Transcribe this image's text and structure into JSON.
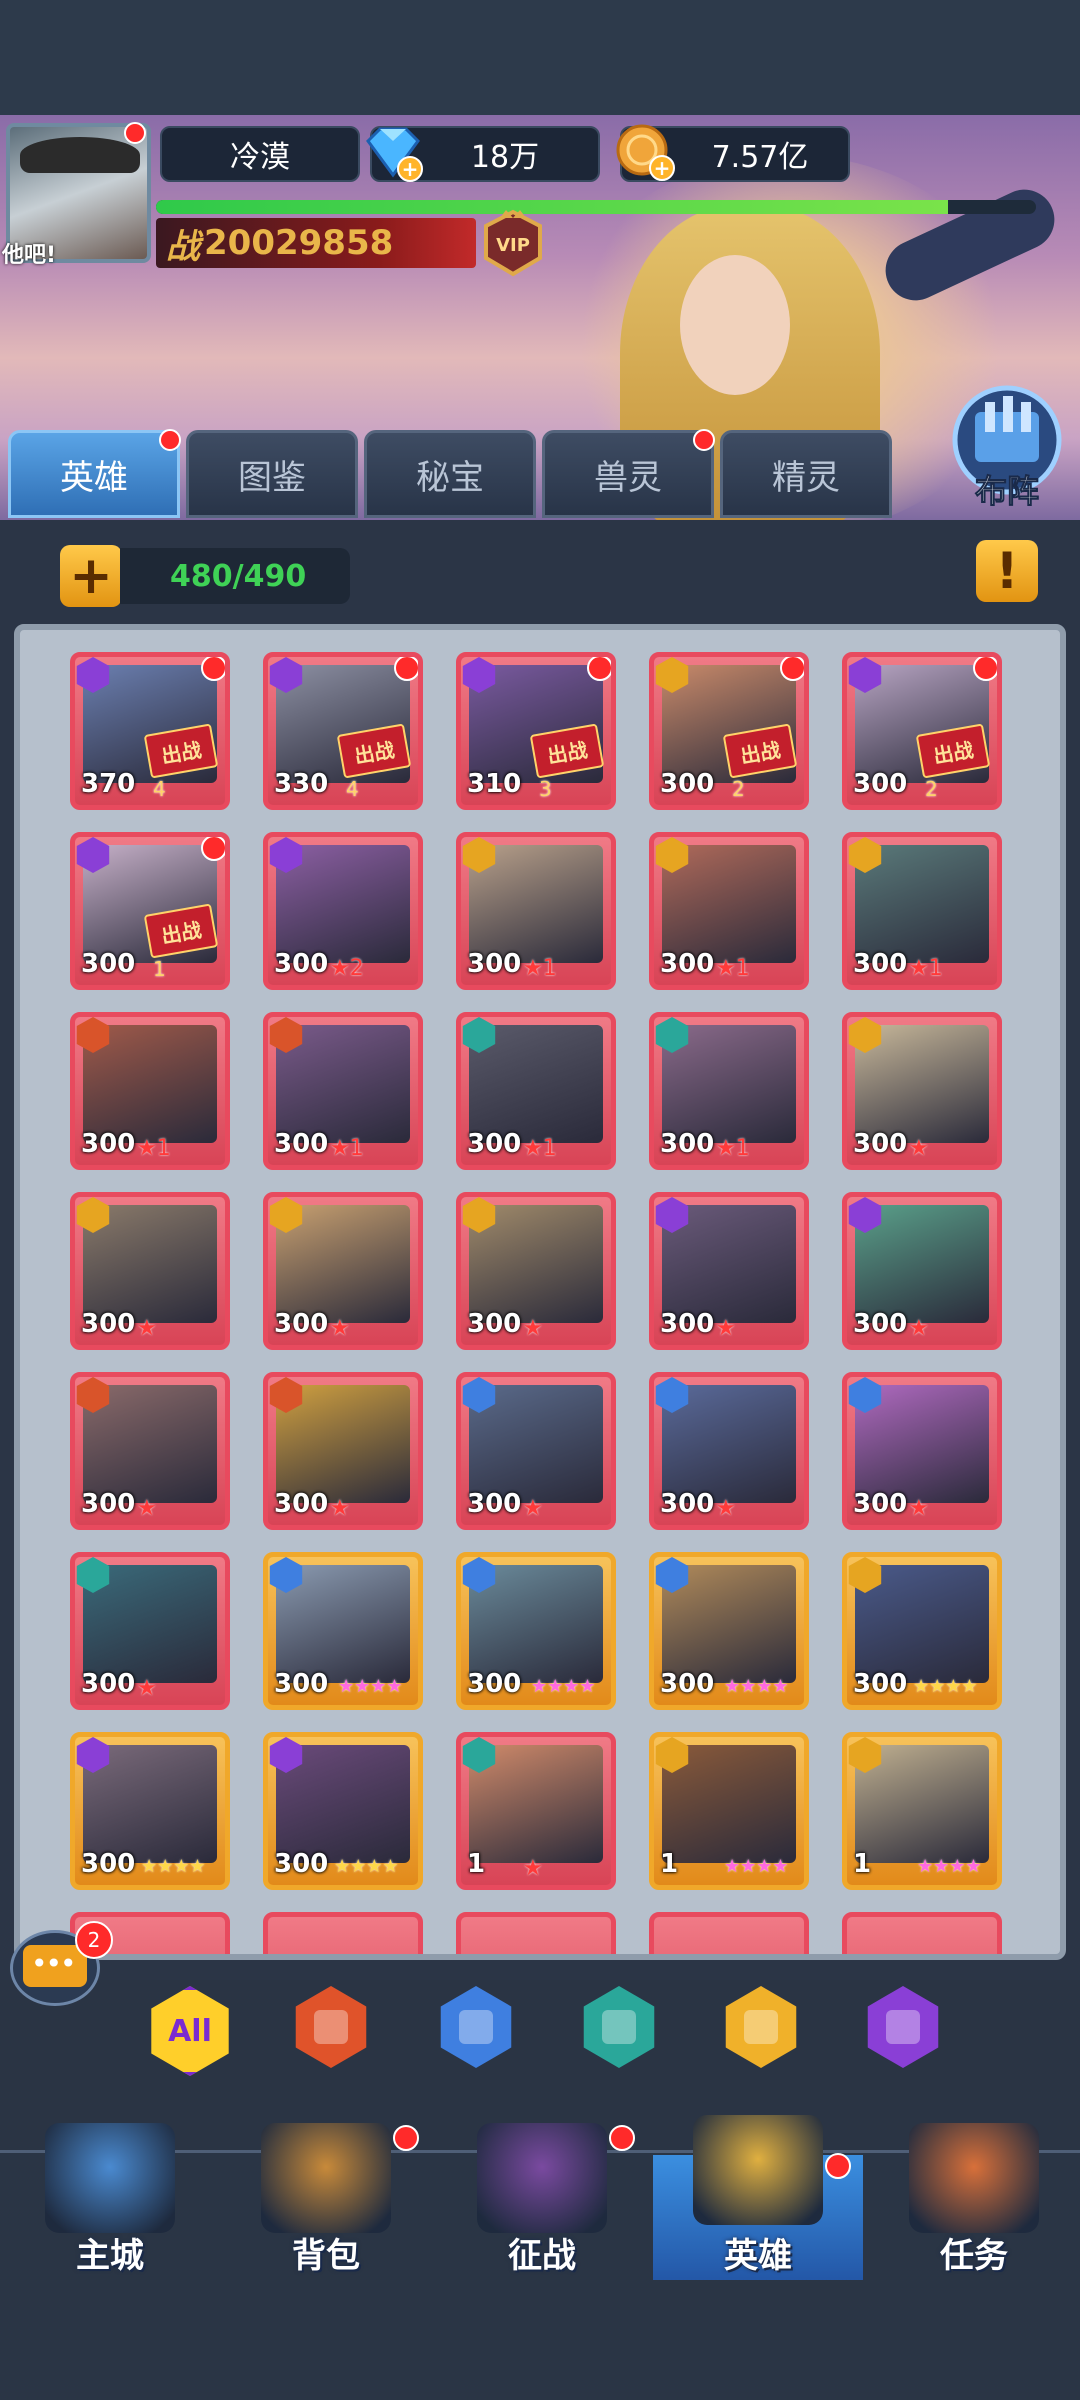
{
  "player": {
    "name": "冷漠",
    "gems": "18万",
    "gold": "7.57亿",
    "avatar_caption": "他吧!",
    "power_prefix": "战",
    "power": "20029858",
    "vip_label": "VIP",
    "xp_progress": 0.9
  },
  "tabs": [
    {
      "label": "英雄",
      "active": true,
      "dot": true
    },
    {
      "label": "图鉴",
      "active": false,
      "dot": false
    },
    {
      "label": "秘宝",
      "active": false,
      "dot": false
    },
    {
      "label": "兽灵",
      "active": false,
      "dot": true
    },
    {
      "label": "精灵",
      "active": false,
      "dot": false
    }
  ],
  "formation_label": "布阵",
  "roster": {
    "count": "480/490",
    "add_label": "+",
    "info_label": "!"
  },
  "deploy_label": "出战",
  "heroes": [
    {
      "level": "370",
      "deploy": "4",
      "faction": "purple",
      "frame": "red",
      "dot": true,
      "stars": ""
    },
    {
      "level": "330",
      "deploy": "4",
      "faction": "purple",
      "frame": "red",
      "dot": true,
      "stars": ""
    },
    {
      "level": "310",
      "deploy": "3",
      "faction": "purple",
      "frame": "red",
      "dot": true,
      "stars": ""
    },
    {
      "level": "300",
      "deploy": "2",
      "faction": "gold",
      "frame": "red",
      "dot": true,
      "stars": ""
    },
    {
      "level": "300",
      "deploy": "2",
      "faction": "purple",
      "frame": "red",
      "dot": true,
      "stars": ""
    },
    {
      "level": "300",
      "deploy": "1",
      "faction": "purple",
      "frame": "red",
      "dot": true,
      "stars": ""
    },
    {
      "level": "300",
      "deploy": "",
      "faction": "purple",
      "frame": "red",
      "dot": false,
      "stars": "★2"
    },
    {
      "level": "300",
      "deploy": "",
      "faction": "gold",
      "frame": "red",
      "dot": false,
      "stars": "★1"
    },
    {
      "level": "300",
      "deploy": "",
      "faction": "gold",
      "frame": "red",
      "dot": false,
      "stars": "★1"
    },
    {
      "level": "300",
      "deploy": "",
      "faction": "gold",
      "frame": "red",
      "dot": false,
      "stars": "★1"
    },
    {
      "level": "300",
      "deploy": "",
      "faction": "orange",
      "frame": "red",
      "dot": false,
      "stars": "★1"
    },
    {
      "level": "300",
      "deploy": "",
      "faction": "orange",
      "frame": "red",
      "dot": false,
      "stars": "★1"
    },
    {
      "level": "300",
      "deploy": "",
      "faction": "teal",
      "frame": "red",
      "dot": false,
      "stars": "★1"
    },
    {
      "level": "300",
      "deploy": "",
      "faction": "teal",
      "frame": "red",
      "dot": false,
      "stars": "★1"
    },
    {
      "level": "300",
      "deploy": "",
      "faction": "gold",
      "frame": "red",
      "dot": false,
      "stars": "★"
    },
    {
      "level": "300",
      "deploy": "",
      "faction": "gold",
      "frame": "red",
      "dot": false,
      "stars": "★"
    },
    {
      "level": "300",
      "deploy": "",
      "faction": "gold",
      "frame": "red",
      "dot": false,
      "stars": "★"
    },
    {
      "level": "300",
      "deploy": "",
      "faction": "gold",
      "frame": "red",
      "dot": false,
      "stars": "★"
    },
    {
      "level": "300",
      "deploy": "",
      "faction": "purple",
      "frame": "red",
      "dot": false,
      "stars": "★"
    },
    {
      "level": "300",
      "deploy": "",
      "faction": "purple",
      "frame": "red",
      "dot": false,
      "stars": "★"
    },
    {
      "level": "300",
      "deploy": "",
      "faction": "orange",
      "frame": "red",
      "dot": false,
      "stars": "★"
    },
    {
      "level": "300",
      "deploy": "",
      "faction": "orange",
      "frame": "red",
      "dot": false,
      "stars": "★"
    },
    {
      "level": "300",
      "deploy": "",
      "faction": "blue",
      "frame": "red",
      "dot": false,
      "stars": "★"
    },
    {
      "level": "300",
      "deploy": "",
      "faction": "blue",
      "frame": "red",
      "dot": false,
      "stars": "★"
    },
    {
      "level": "300",
      "deploy": "",
      "faction": "blue",
      "frame": "red",
      "dot": false,
      "stars": "★"
    },
    {
      "level": "300",
      "deploy": "",
      "faction": "teal",
      "frame": "red",
      "dot": false,
      "stars": "★"
    },
    {
      "level": "300",
      "deploy": "",
      "faction": "blue",
      "frame": "gold",
      "dot": false,
      "stars": "★★★★",
      "star_style": "pink"
    },
    {
      "level": "300",
      "deploy": "",
      "faction": "blue",
      "frame": "gold",
      "dot": false,
      "stars": "★★★★",
      "star_style": "pink"
    },
    {
      "level": "300",
      "deploy": "",
      "faction": "blue",
      "frame": "gold",
      "dot": false,
      "stars": "★★★★",
      "star_style": "pink"
    },
    {
      "level": "300",
      "deploy": "",
      "faction": "gold",
      "frame": "gold",
      "dot": false,
      "stars": "★★★★",
      "star_style": "gold"
    },
    {
      "level": "300",
      "deploy": "",
      "faction": "purple",
      "frame": "gold",
      "dot": false,
      "stars": "★★★★",
      "star_style": "gold"
    },
    {
      "level": "300",
      "deploy": "",
      "faction": "purple",
      "frame": "gold",
      "dot": false,
      "stars": "★★★★",
      "star_style": "gold"
    },
    {
      "level": "1",
      "deploy": "",
      "faction": "teal",
      "frame": "red",
      "dot": false,
      "stars": "★"
    },
    {
      "level": "1",
      "deploy": "",
      "faction": "gold",
      "frame": "gold",
      "dot": false,
      "stars": "★★★★",
      "star_style": "pink"
    },
    {
      "level": "1",
      "deploy": "",
      "faction": "gold",
      "frame": "gold",
      "dot": false,
      "stars": "★★★★",
      "star_style": "pink"
    }
  ],
  "filters": [
    {
      "label": "All",
      "color": "#ffcf2a",
      "text_color": "#7b2bd1"
    },
    {
      "label": "",
      "color": "#e0532a",
      "icon": "fire-faction-icon"
    },
    {
      "label": "",
      "color": "#3f7fe0",
      "icon": "light-faction-icon"
    },
    {
      "label": "",
      "color": "#2aa79a",
      "icon": "skull-faction-icon"
    },
    {
      "label": "",
      "color": "#f0b12a",
      "icon": "wing-faction-icon"
    },
    {
      "label": "",
      "color": "#8a3fd6",
      "icon": "demon-faction-icon"
    }
  ],
  "chat": {
    "badge": "2"
  },
  "nav": [
    {
      "label": "主城",
      "active": false,
      "dot": false,
      "icon": "castle-icon"
    },
    {
      "label": "背包",
      "active": false,
      "dot": true,
      "icon": "chest-icon"
    },
    {
      "label": "征战",
      "active": false,
      "dot": true,
      "icon": "portal-icon"
    },
    {
      "label": "英雄",
      "active": true,
      "dot": true,
      "icon": "helmet-icon"
    },
    {
      "label": "任务",
      "active": false,
      "dot": false,
      "icon": "scroll-icon"
    }
  ],
  "faction_colors": {
    "purple": "#8a3fd6",
    "gold": "#e6a521",
    "orange": "#d9542a",
    "teal": "#2aa79a",
    "blue": "#3f7fe0"
  }
}
